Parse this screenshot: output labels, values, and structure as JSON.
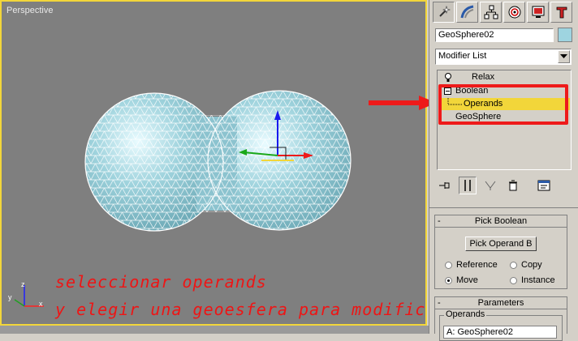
{
  "viewport": {
    "label": "Perspective",
    "captions": [
      "seleccionar operands",
      "y elegir una geoesfera para modificar"
    ],
    "axis_labels": {
      "x": "x",
      "y": "y",
      "z": "z"
    }
  },
  "command_panel": {
    "tabs": [
      "create-icon",
      "modify-icon",
      "hierarchy-icon",
      "motion-icon",
      "display-icon",
      "utilities-icon"
    ],
    "object_name": "GeoSphere02",
    "object_color": "#9ed4e0",
    "modifier_list": "Modifier List",
    "stack": [
      {
        "label": "Relax",
        "icon": "lightbulb-icon"
      },
      {
        "label": "Boolean",
        "icon": "collapse-box-icon"
      },
      {
        "label": "Operands",
        "selected": true
      },
      {
        "label": "GeoSphere"
      }
    ],
    "stack_tools": [
      "pin-stack-icon",
      "show-end-result-icon",
      "make-unique-icon",
      "remove-modifier-icon",
      "configure-sets-icon"
    ]
  },
  "pick_boolean": {
    "title": "Pick Boolean",
    "toggle": "-",
    "button": "Pick Operand B",
    "options": [
      {
        "label": "Reference",
        "checked": false
      },
      {
        "label": "Copy",
        "checked": false
      },
      {
        "label": "Move",
        "checked": true
      },
      {
        "label": "Instance",
        "checked": false
      }
    ]
  },
  "parameters": {
    "title": "Parameters",
    "toggle": "-",
    "operands_label": "Operands",
    "operand_item": "A: GeoSphere02"
  },
  "colors": {
    "viewport_border": "#f2d63a",
    "annotation": "#ee1515",
    "highlight": "#f2d63a"
  }
}
